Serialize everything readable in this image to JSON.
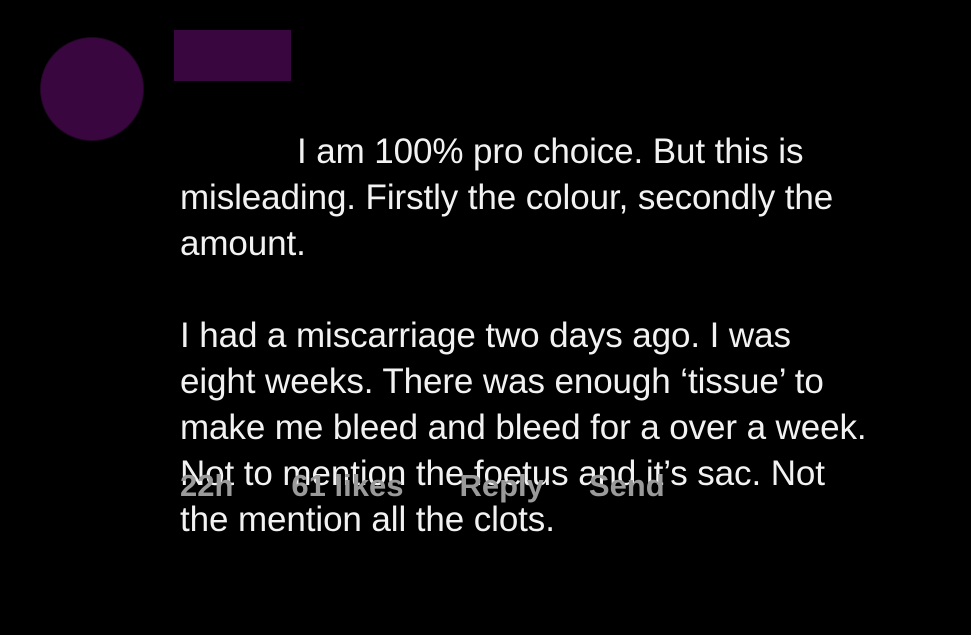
{
  "comment": {
    "first_line": "I am 100% pro choice. But this is",
    "paragraph_1_rest": "misleading. Firstly the colour, secondly the\namount.",
    "paragraph_2": "I had a miscarriage two days ago. I was\neight weeks. There was enough ‘tissue’ to\nmake me bleed and bleed for a over a week.\nNot to mention the foetus and it’s sac. Not\nthe mention all the clots.",
    "timestamp": "22h",
    "likes": "61 likes",
    "reply_label": "Reply",
    "send_label": "Send"
  },
  "colors": {
    "background": "#000000",
    "avatar": "#3a0640",
    "redaction": "#3a0640",
    "text": "#f2f2f2",
    "meta_text": "#9a9a9a"
  }
}
